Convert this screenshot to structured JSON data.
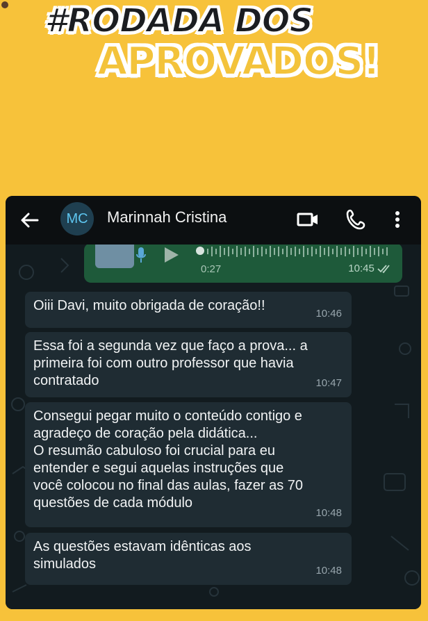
{
  "headline": {
    "line1": "#RODADA DOS",
    "line2": "APROVADOS!"
  },
  "appbar": {
    "back_icon": "arrow-left-icon",
    "avatar_initials": "MC",
    "contact_name": "Marinnah Cristina",
    "video_icon": "video-camera-icon",
    "call_icon": "phone-icon",
    "menu_icon": "more-vertical-icon"
  },
  "audio_message": {
    "duration": "0:27",
    "time": "10:45",
    "status_icon": "double-check-icon"
  },
  "messages": [
    {
      "text": "Oiii Davi, muito obrigada de coração!!",
      "time": "10:46"
    },
    {
      "text": "Essa foi a segunda vez que faço a prova... a\nprimeira foi com outro professor que havia\ncontratado",
      "time": "10:47"
    },
    {
      "text": "Consegui pegar muito o conteúdo contigo e\nagradeço de coração pela didática...\nO resumão cabuloso foi crucial para eu\nentender e segui aquelas instruções que\nvocê colocou no final das aulas, fazer as 70\nquestões de cada módulo",
      "time": "10:48"
    },
    {
      "text": "As questões estavam idênticas aos\nsimulados",
      "time": "10:48"
    }
  ],
  "colors": {
    "background": "#f7c23a",
    "chat_bg": "#121b1f",
    "incoming_bubble": "#1f2c33",
    "outgoing_bubble": "#1e5a3a",
    "avatar_text": "#5ec6f0"
  }
}
